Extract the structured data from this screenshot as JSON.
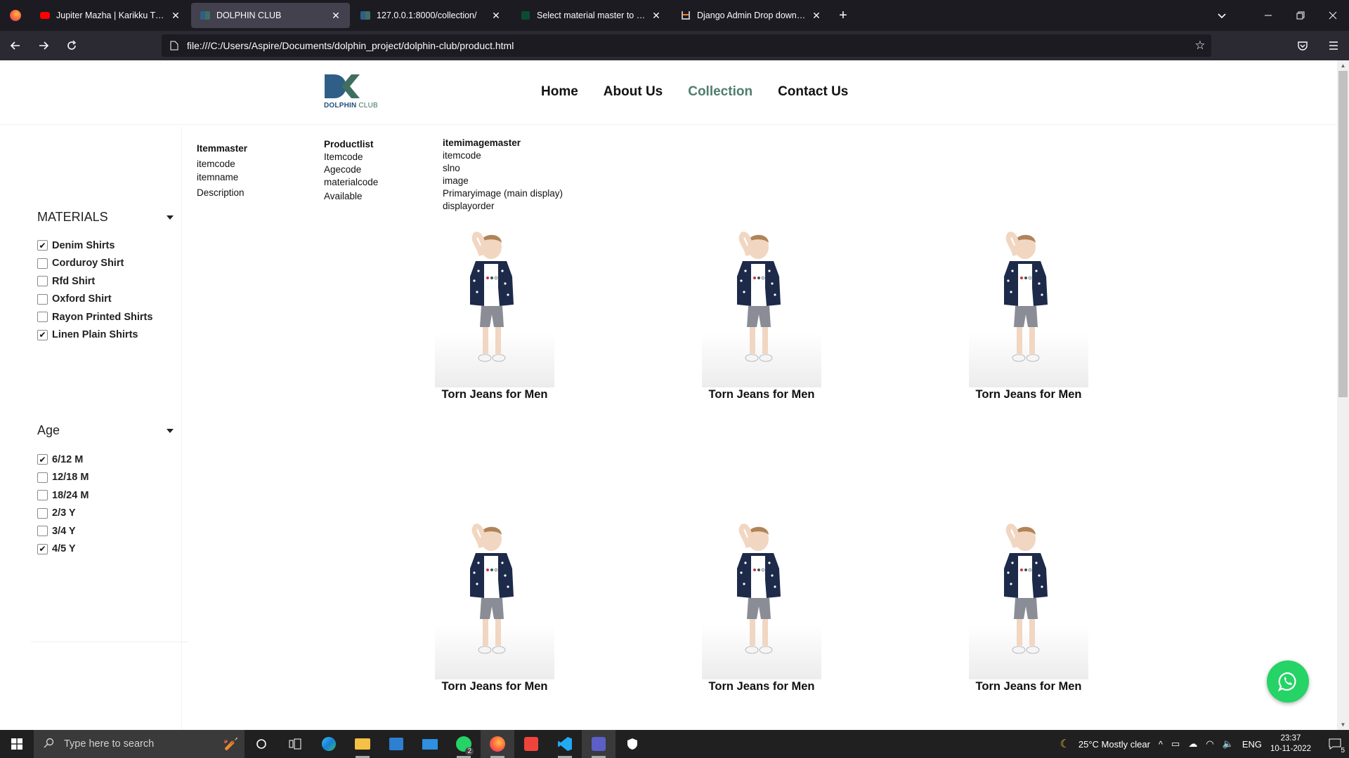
{
  "browser": {
    "tabs": [
      {
        "title": "Jupiter Mazha | Karikku Tuned |",
        "favicon": "youtube-icon",
        "active": false
      },
      {
        "title": "DOLPHIN CLUB",
        "favicon": "dolphin-club-icon",
        "active": true
      },
      {
        "title": "127.0.0.1:8000/collection/",
        "favicon": "dolphin-club-icon",
        "active": false
      },
      {
        "title": "Select material master to change | D",
        "favicon": "django-icon",
        "active": false
      },
      {
        "title": "Django Admin Drop down selec",
        "favicon": "stackoverflow-icon",
        "active": false
      }
    ],
    "url": "file:///C:/Users/Aspire/Documents/dolphin_project/dolphin-club/product.html"
  },
  "site": {
    "logo_text_main": "DOLPHIN",
    "logo_text_sub": "CLUB",
    "nav": [
      {
        "label": "Home",
        "active": false
      },
      {
        "label": "About Us",
        "active": false
      },
      {
        "label": "Collection",
        "active": true
      },
      {
        "label": "Contact Us",
        "active": false
      }
    ],
    "active_color": "#4f7d6f"
  },
  "filters": {
    "materials": {
      "title": "MATERIALS",
      "items": [
        {
          "label": "Denim Shirts",
          "checked": true
        },
        {
          "label": "Corduroy Shirt",
          "checked": false
        },
        {
          "label": "Rfd Shirt",
          "checked": false
        },
        {
          "label": "Oxford Shirt",
          "checked": false
        },
        {
          "label": "Rayon Printed Shirts",
          "checked": false
        },
        {
          "label": "Linen Plain Shirts",
          "checked": true
        }
      ]
    },
    "age": {
      "title": "Age",
      "items": [
        {
          "label": "6/12 M",
          "checked": true
        },
        {
          "label": "12/18 M",
          "checked": false
        },
        {
          "label": "18/24 M",
          "checked": false
        },
        {
          "label": "2/3 Y",
          "checked": false
        },
        {
          "label": "3/4 Y",
          "checked": false
        },
        {
          "label": "4/5 Y",
          "checked": true
        }
      ]
    }
  },
  "schema": {
    "itemmaster": {
      "title": "Itemmaster",
      "fields": [
        "itemcode",
        "itemname",
        "Description"
      ]
    },
    "productlist": {
      "title": "Productlist",
      "fields": [
        "Itemcode",
        "Agecode",
        "materialcode",
        "Available"
      ]
    },
    "itemimagemaster": {
      "title": "itemimagemaster",
      "fields": [
        "itemcode",
        "slno",
        "image",
        "Primaryimage (main display)",
        "displayorder"
      ]
    }
  },
  "products": [
    {
      "name": "Torn Jeans for Men"
    },
    {
      "name": "Torn Jeans for Men"
    },
    {
      "name": "Torn Jeans for Men"
    },
    {
      "name": "Torn Jeans for Men"
    },
    {
      "name": "Torn Jeans for Men"
    },
    {
      "name": "Torn Jeans for Men"
    }
  ],
  "taskbar": {
    "search_placeholder": "Type here to search",
    "weather": "25°C  Mostly clear",
    "language": "ENG",
    "time": "23:37",
    "date": "10-11-2022",
    "notification_count": "5",
    "whatsapp_badge": "2"
  }
}
